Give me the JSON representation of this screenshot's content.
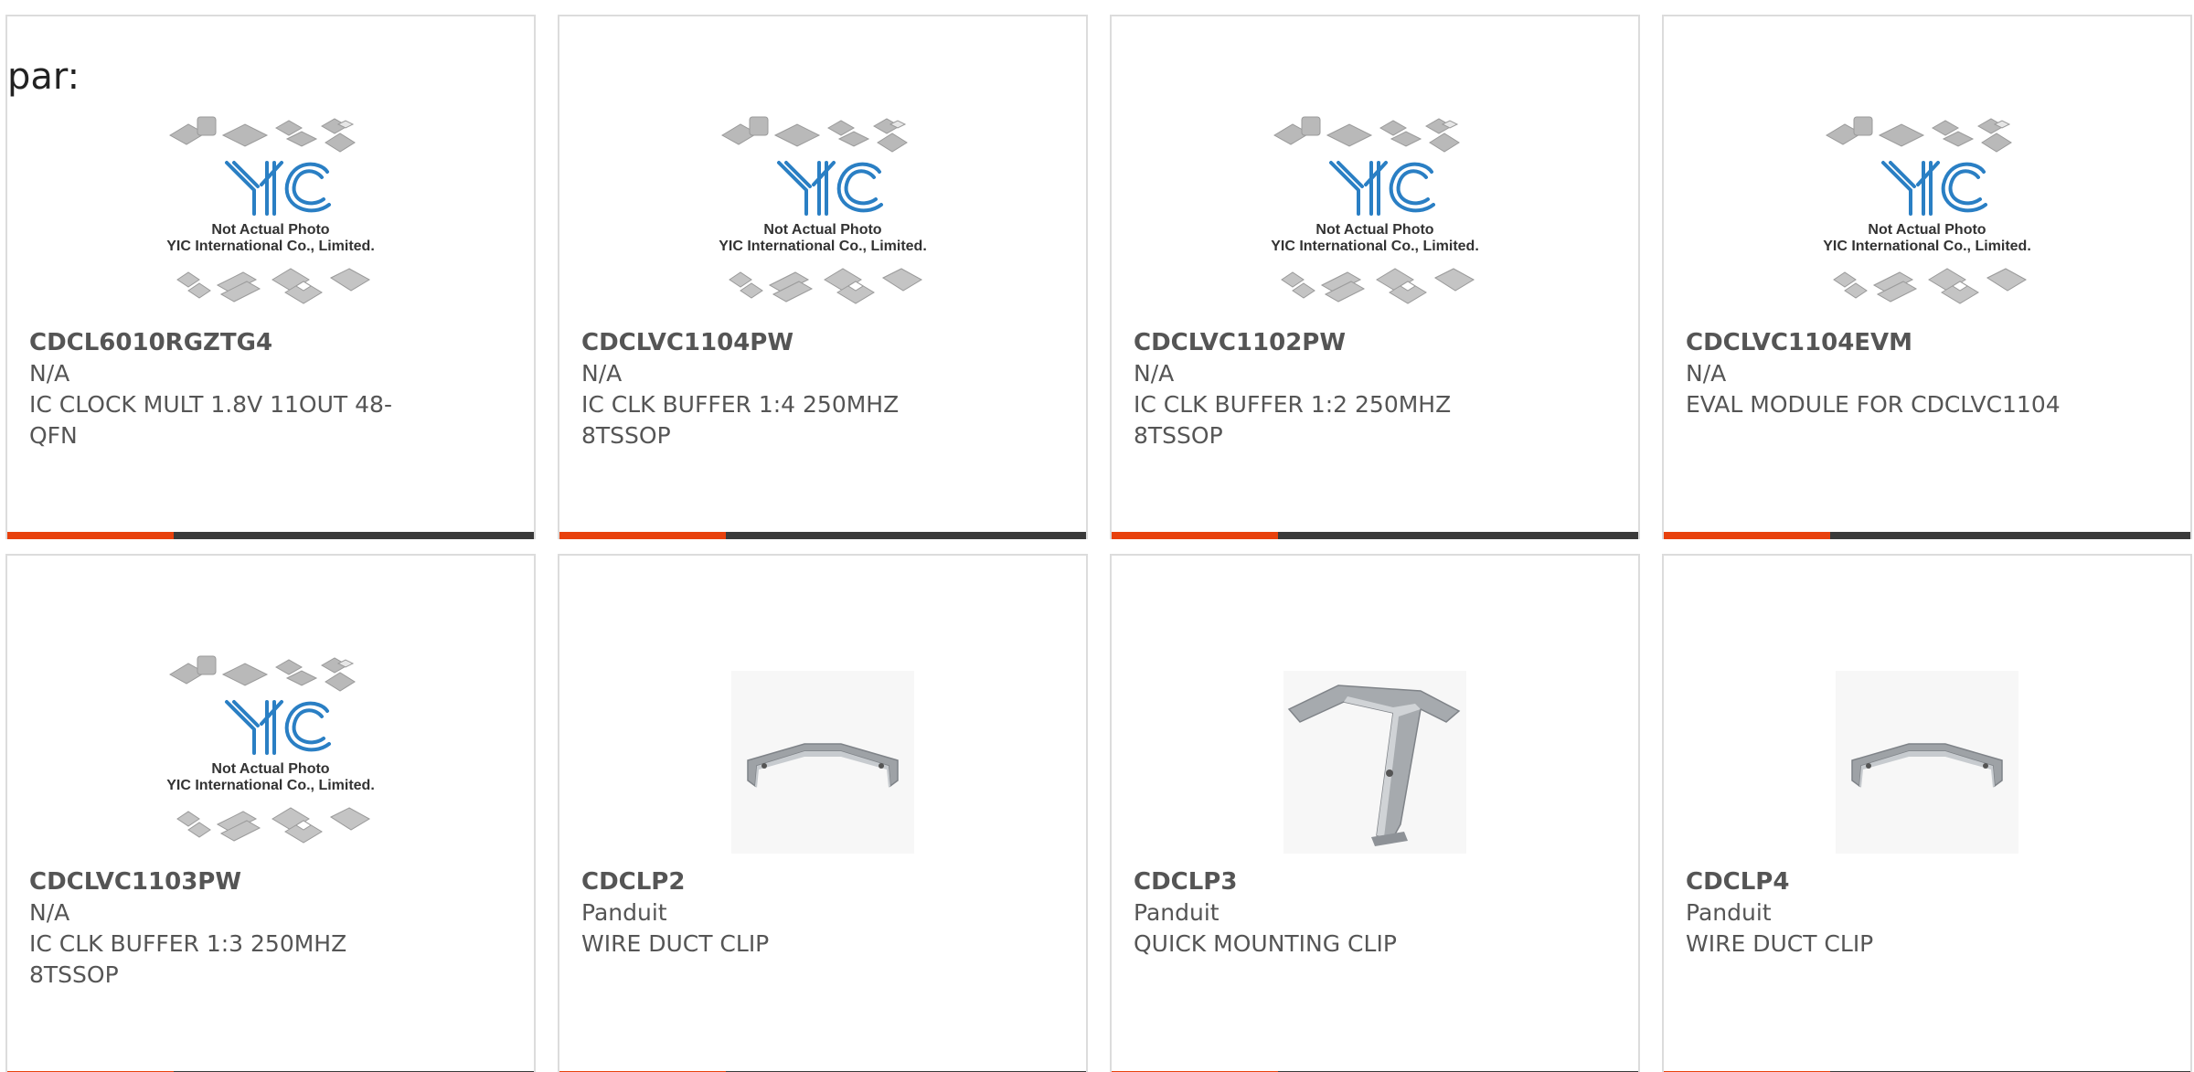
{
  "prefix_label": "par:",
  "placeholder_text": {
    "line1": "Not Actual Photo",
    "line2": "YIC International Co., Limited.",
    "logo": "YIC"
  },
  "colors": {
    "accent": "#e8410d",
    "bar": "#3a3a3a",
    "border": "#dcdcdc",
    "logo_blue": "#2a7fc4"
  },
  "products": [
    {
      "part": "CDCL6010RGZTG4",
      "manufacturer": "N/A",
      "description": "IC CLOCK MULT 1.8V 11OUT 48-QFN",
      "image": "placeholder"
    },
    {
      "part": "CDCLVC1104PW",
      "manufacturer": "N/A",
      "description": "IC CLK BUFFER 1:4 250MHZ 8TSSOP",
      "image": "placeholder"
    },
    {
      "part": "CDCLVC1102PW",
      "manufacturer": "N/A",
      "description": "IC CLK BUFFER 1:2 250MHZ 8TSSOP",
      "image": "placeholder"
    },
    {
      "part": "CDCLVC1104EVM",
      "manufacturer": "N/A",
      "description": "EVAL MODULE FOR CDCLVC1104",
      "image": "placeholder"
    },
    {
      "part": "CDCLVC1103PW",
      "manufacturer": "N/A",
      "description": "IC CLK BUFFER 1:3 250MHZ 8TSSOP",
      "image": "placeholder"
    },
    {
      "part": "CDCLP2",
      "manufacturer": "Panduit",
      "description": "WIRE DUCT CLIP",
      "image": "clip-flat"
    },
    {
      "part": "CDCLP3",
      "manufacturer": "Panduit",
      "description": "QUICK MOUNTING CLIP",
      "image": "clip-bent"
    },
    {
      "part": "CDCLP4",
      "manufacturer": "Panduit",
      "description": "WIRE DUCT CLIP",
      "image": "clip-flat"
    }
  ]
}
